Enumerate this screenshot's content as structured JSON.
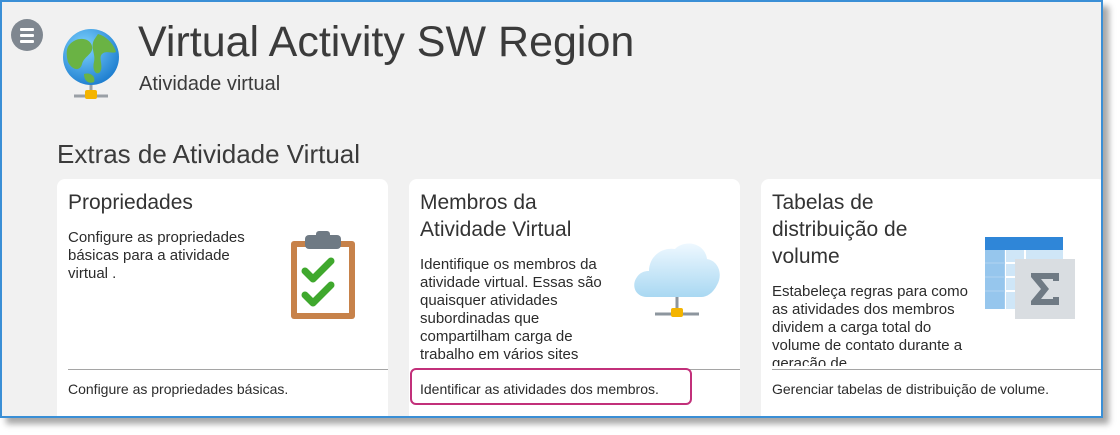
{
  "header": {
    "title": "Virtual Activity SW Region",
    "subtitle": "Atividade virtual",
    "menu_icon": "hamburger-menu-icon",
    "logo_icon": "globe-network-icon"
  },
  "section": {
    "title": "Extras de Atividade Virtual"
  },
  "cards": [
    {
      "title": "Propriedades",
      "description": "Configure as propriedades básicas para a atividade virtual .",
      "link": "Configure as propriedades básicas.",
      "icon": "clipboard-checklist-icon"
    },
    {
      "title": "Membros da Atividade Virtual",
      "description": "Identifique os membros da atividade virtual. Essas são quaisquer atividades subordinadas que compartilham carga de trabalho em vários sites",
      "link": "Identificar as atividades dos membros.",
      "icon": "cloud-network-icon"
    },
    {
      "title": "Tabelas de distribuição de volume",
      "description": "Estabeleça regras para como as atividades dos membros dividem a carga total do volume de contato durante a geração de",
      "link": "Gerenciar tabelas de distribuição de volume.",
      "icon": "table-sum-icon"
    }
  ],
  "colors": {
    "frame_border": "#3a8fd6",
    "highlight": "#c2307a",
    "check_green": "#3fa82d"
  }
}
